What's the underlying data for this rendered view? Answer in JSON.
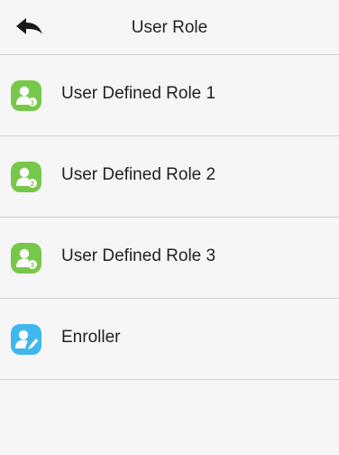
{
  "header": {
    "title": "User Role",
    "back_icon": "back-arrow-icon"
  },
  "colors": {
    "role_icon": "#77c84a",
    "enroller_icon": "#3eb7ee",
    "divider": "#cfcfcf",
    "background": "#f6f6f6"
  },
  "roles": [
    {
      "label": "User Defined Role 1",
      "badge": "1",
      "icon": "user-role-1-icon"
    },
    {
      "label": "User Defined Role 2",
      "badge": "2",
      "icon": "user-role-2-icon"
    },
    {
      "label": "User Defined Role 3",
      "badge": "3",
      "icon": "user-role-3-icon"
    },
    {
      "label": "Enroller",
      "badge": "",
      "icon": "enroller-icon"
    }
  ]
}
